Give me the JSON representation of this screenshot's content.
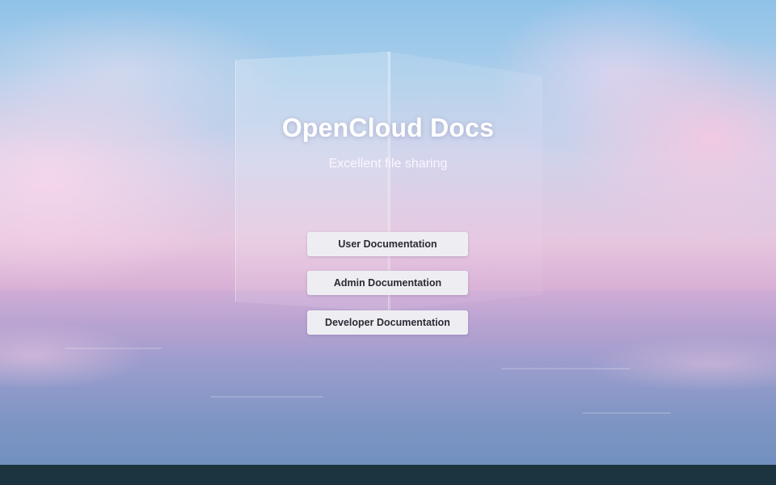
{
  "hero": {
    "title": "OpenCloud Docs",
    "subtitle": "Excellent file sharing"
  },
  "buttons": [
    {
      "label": "User Documentation"
    },
    {
      "label": "Admin Documentation"
    },
    {
      "label": "Developer Documentation"
    }
  ],
  "colors": {
    "footer_bg": "#1b3440",
    "button_bg": "#eeeef2",
    "button_text": "#2a2a35",
    "title_text": "#ffffff"
  }
}
